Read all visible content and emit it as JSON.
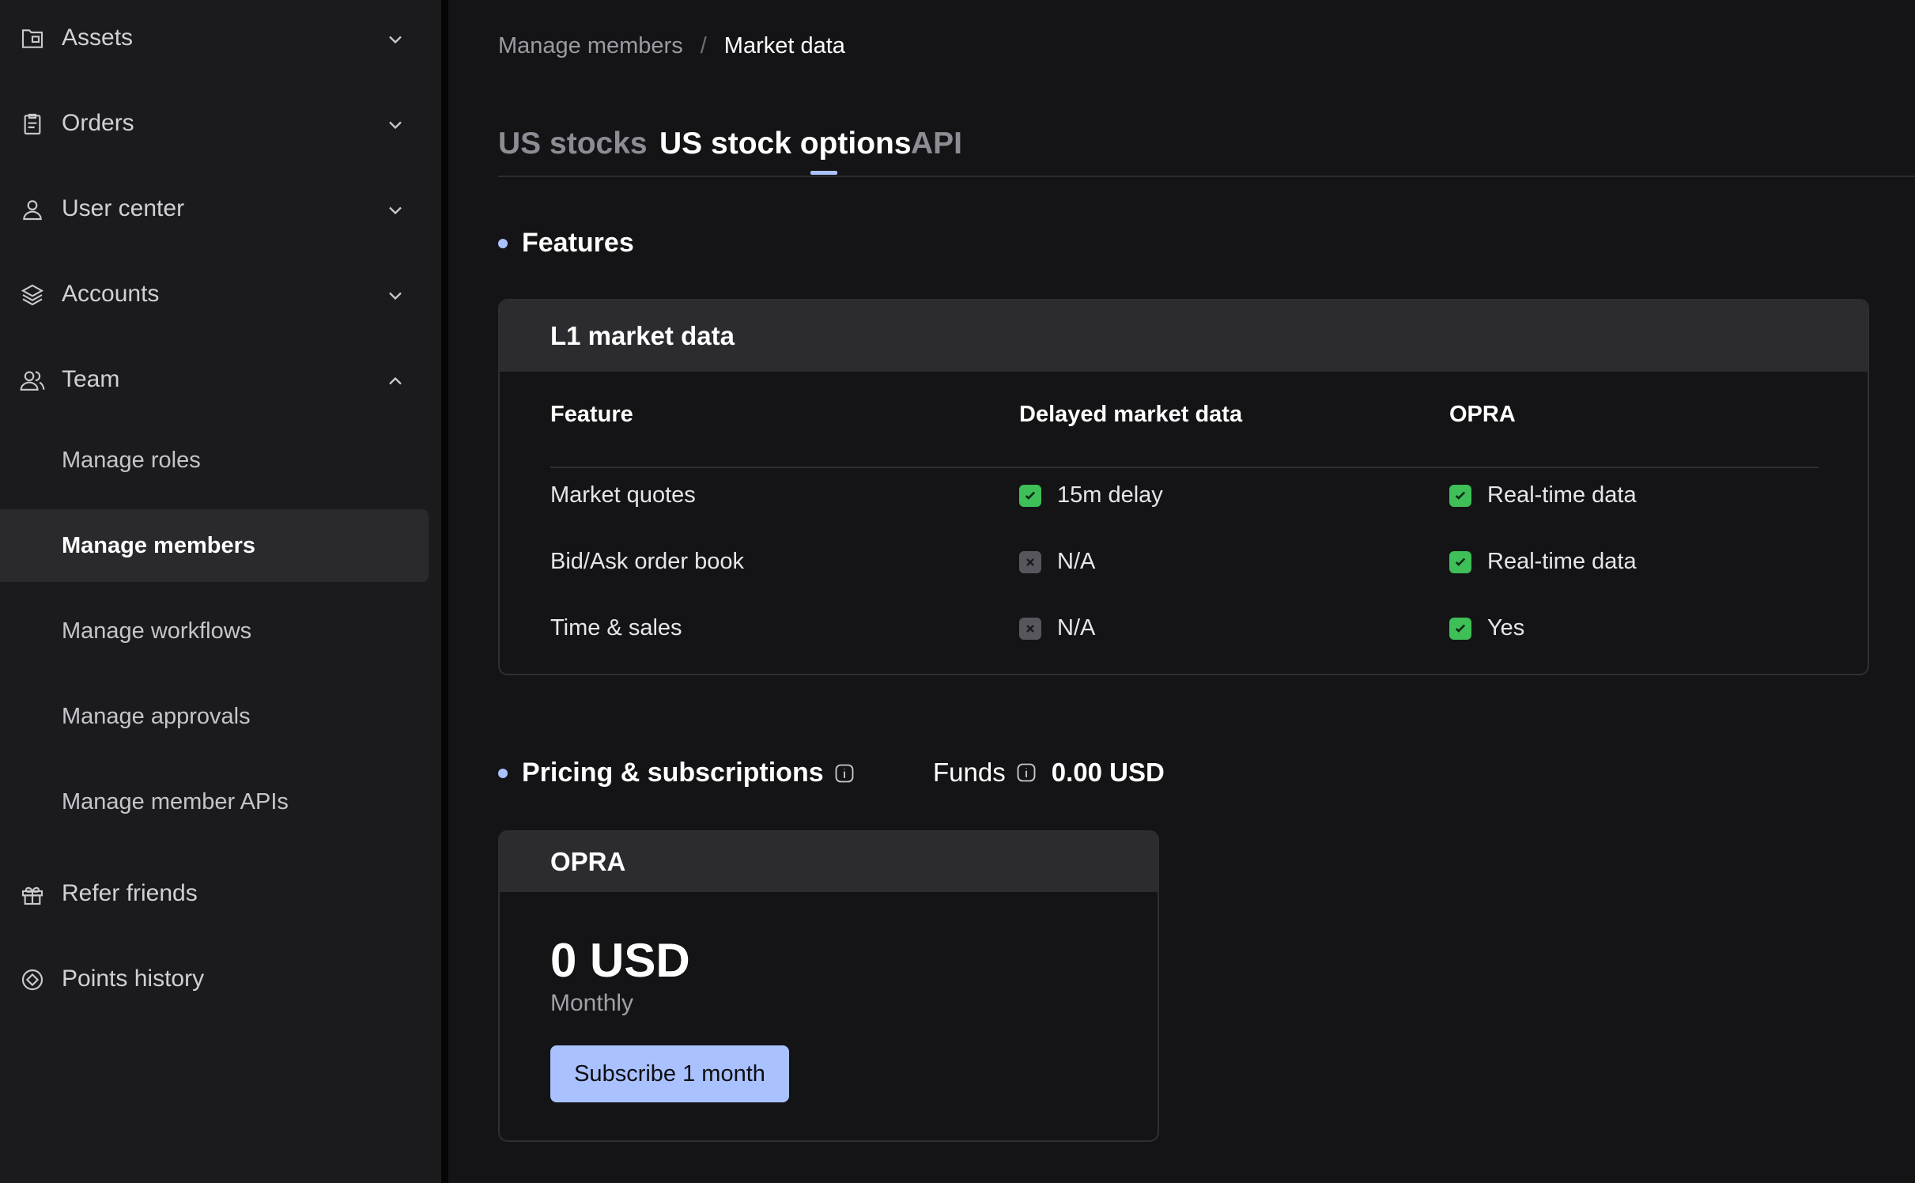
{
  "sidebar": {
    "items": [
      {
        "label": "Assets",
        "icon": "folder-icon",
        "expanded": false
      },
      {
        "label": "Orders",
        "icon": "clipboard-icon",
        "expanded": false
      },
      {
        "label": "User center",
        "icon": "user-icon",
        "expanded": false
      },
      {
        "label": "Accounts",
        "icon": "layers-icon",
        "expanded": false
      },
      {
        "label": "Team",
        "icon": "team-icon",
        "expanded": true
      },
      {
        "label": "Refer friends",
        "icon": "gift-icon"
      },
      {
        "label": "Points history",
        "icon": "points-icon"
      }
    ],
    "team_sub": [
      "Manage roles",
      "Manage members",
      "Manage workflows",
      "Manage approvals",
      "Manage member APIs"
    ],
    "active_sub": "Manage members"
  },
  "breadcrumb": {
    "parent": "Manage members",
    "separator": "/",
    "current": "Market data"
  },
  "tabs": [
    {
      "label": "US stocks",
      "active": false
    },
    {
      "label": "US stock options",
      "active": true
    },
    {
      "label": "API",
      "active": false
    }
  ],
  "features": {
    "title": "Features",
    "card_title": "L1 market data",
    "headers": [
      "Feature",
      "Delayed market data",
      "OPRA"
    ],
    "rows": [
      {
        "feature": "Market quotes",
        "delayed": {
          "status": "yes",
          "text": "15m delay"
        },
        "opra": {
          "status": "yes",
          "text": "Real-time data"
        }
      },
      {
        "feature": "Bid/Ask order book",
        "delayed": {
          "status": "no",
          "text": "N/A"
        },
        "opra": {
          "status": "yes",
          "text": "Real-time data"
        }
      },
      {
        "feature": "Time & sales",
        "delayed": {
          "status": "no",
          "text": "N/A"
        },
        "opra": {
          "status": "yes",
          "text": "Yes"
        }
      }
    ]
  },
  "pricing": {
    "title": "Pricing & subscriptions",
    "funds_label": "Funds",
    "funds_value": "0.00 USD",
    "plan": {
      "name": "OPRA",
      "price": "0 USD",
      "period": "Monthly",
      "button": "Subscribe 1 month"
    }
  },
  "colors": {
    "accent": "#a9c1ff",
    "check": "#3fbf57",
    "cross": "#56565c"
  }
}
